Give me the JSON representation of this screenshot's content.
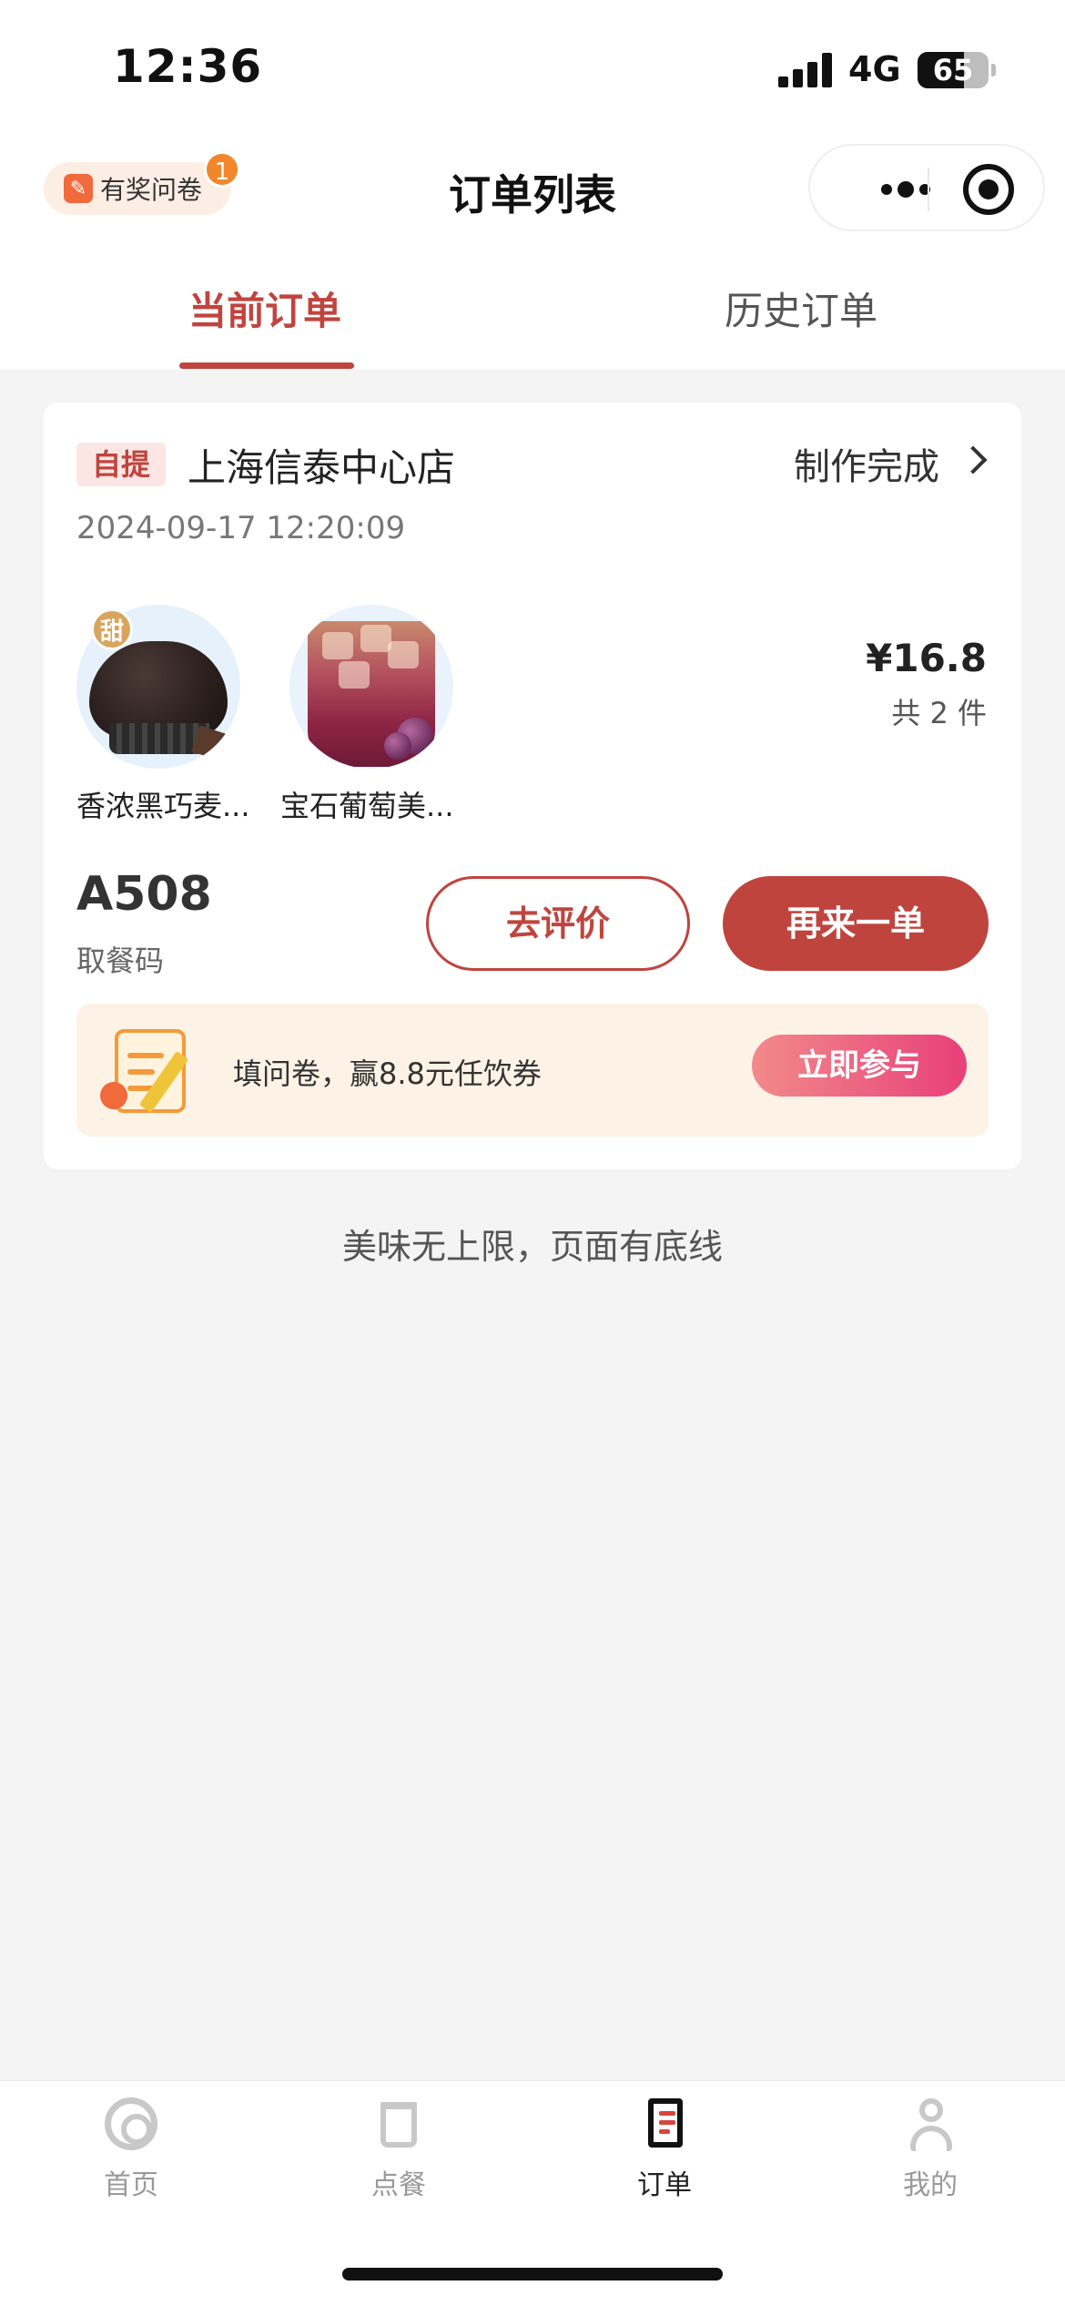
{
  "status_bar": {
    "time": "12:36",
    "network": "4G",
    "battery": "65"
  },
  "header": {
    "survey_label": "有奖问卷",
    "survey_badge": "1",
    "title": "订单列表"
  },
  "tabs": [
    {
      "label": "当前订单",
      "active": true
    },
    {
      "label": "历史订单",
      "active": false
    }
  ],
  "order": {
    "pickup_tag": "自提",
    "store": "上海信泰中心店",
    "status": "制作完成",
    "time": "2024-09-17 12:20:09",
    "items": [
      {
        "name": "香浓黑巧麦...",
        "badge": "甜",
        "icon": "chocolate-muffin"
      },
      {
        "name": "宝石葡萄美...",
        "icon": "grape-drink"
      }
    ],
    "price": "¥16.8",
    "quantity": "共 2 件",
    "pickup_code": "A508",
    "pickup_code_label": "取餐码",
    "review_label": "去评价",
    "reorder_label": "再来一单"
  },
  "promo": {
    "text": "填问卷，赢8.8元任饮券",
    "button": "立即参与"
  },
  "footer_text": "美味无上限，页面有底线",
  "nav": [
    {
      "label": "首页",
      "icon": "at-icon",
      "active": false
    },
    {
      "label": "点餐",
      "icon": "cup-icon",
      "active": false
    },
    {
      "label": "订单",
      "icon": "order-icon",
      "active": true
    },
    {
      "label": "我的",
      "icon": "user-icon",
      "active": false
    }
  ],
  "colors": {
    "accent": "#c0443e",
    "background": "#f4f4f4",
    "promo_bg": "#fdf2e6"
  }
}
